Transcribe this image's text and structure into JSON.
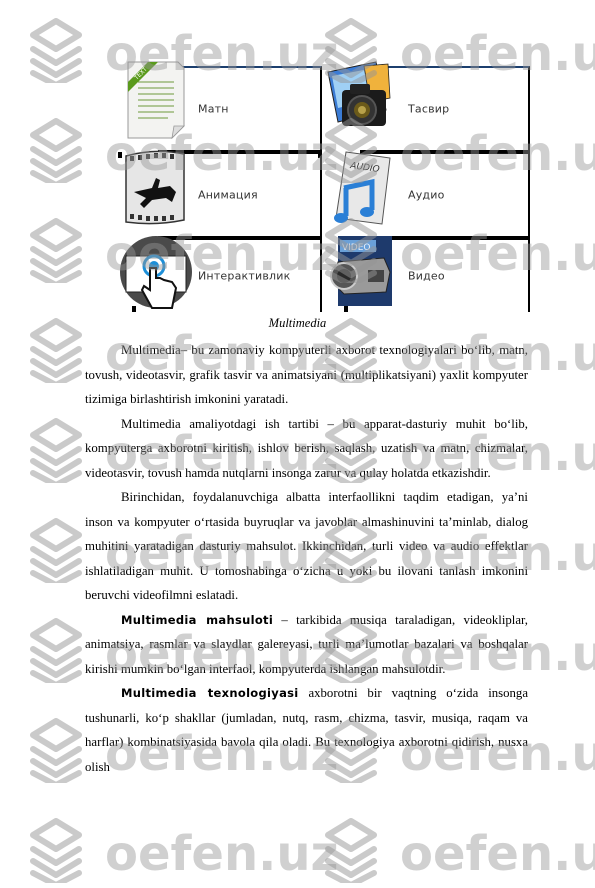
{
  "figure": {
    "items": [
      {
        "label": "Матн",
        "icon": "text-document-icon"
      },
      {
        "label": "Тасвир",
        "icon": "camera-photo-icon"
      },
      {
        "label": "Анимация",
        "icon": "film-strip-horse-icon"
      },
      {
        "label": "Аудио",
        "icon": "audio-note-icon"
      },
      {
        "label": "Интерактивлик",
        "icon": "touch-screen-hand-icon"
      },
      {
        "label": "Видео",
        "icon": "video-camera-icon"
      }
    ],
    "icon_texts": {
      "text_tag": "TEXT",
      "audio_tag": "AUDIO",
      "video_tag": "VIDEO"
    },
    "caption": "Multimedia"
  },
  "paragraphs": [
    {
      "bold": "",
      "text": "Multimedia– bu zamonaviy kompyuterli axborot texnologiyalari bo‘lib, matn, tovush, videotasvir, grafik tasvir va animatsiyani (multiplikatsiyani) yaxlit kompyuter tizimiga birlashtirish imkonini yaratadi."
    },
    {
      "bold": "",
      "text": "Multimedia amaliyotdagi ish tartibi – bu apparat-dasturiy muhit bo‘lib, kompyuterga axborotni kiritish, ishlov berish, saqlash, uzatish va matn, chizmalar, videotasvir, tovush hamda nutqlarni insonga zarur va qulay holatda etkazishdir."
    },
    {
      "bold": "",
      "text": "Birinchidan, foydalanuvchiga albatta interfaollikni taqdim etadigan, ya’ni inson va kompyuter o‘rtasida buyruqlar va javoblar almashinuvini ta’minlab, dialog muhitini yaratadigan dasturiy mahsulot. Ikkinchidan, turli video va audio effektlar ishlatiladigan muhit. U tomoshabinga o‘zicha u yoki bu ilovani tanlash imkonini beruvchi videofilmni eslatadi."
    },
    {
      "bold": "Multimedia mahsuloti",
      "text": " – tarkibida musiqa taraladigan, videokliplar, animatsiya, rasmlar va slaydlar galereyasi, turli ma’lumotlar bazalari va boshqalar kirishi mumkin bo‘lgan interfaol, kompyuterda ishlangan mahsulotdir."
    },
    {
      "bold": "Multimedia texnologiyasi",
      "text": " axborotni bir vaqtning o‘zida insonga tushunarli, ko‘p shakllar (jumladan, nutq, rasm, chizma, tasvir, musiqa, raqam va harflar) kombinatsiyasida bavola qila oladi. Bu texnologiya axborotni qidirish, nusxa olish"
    }
  ],
  "watermark": {
    "text": "oefen.uz",
    "icon": "layers-logo-icon",
    "color": "#969696"
  }
}
